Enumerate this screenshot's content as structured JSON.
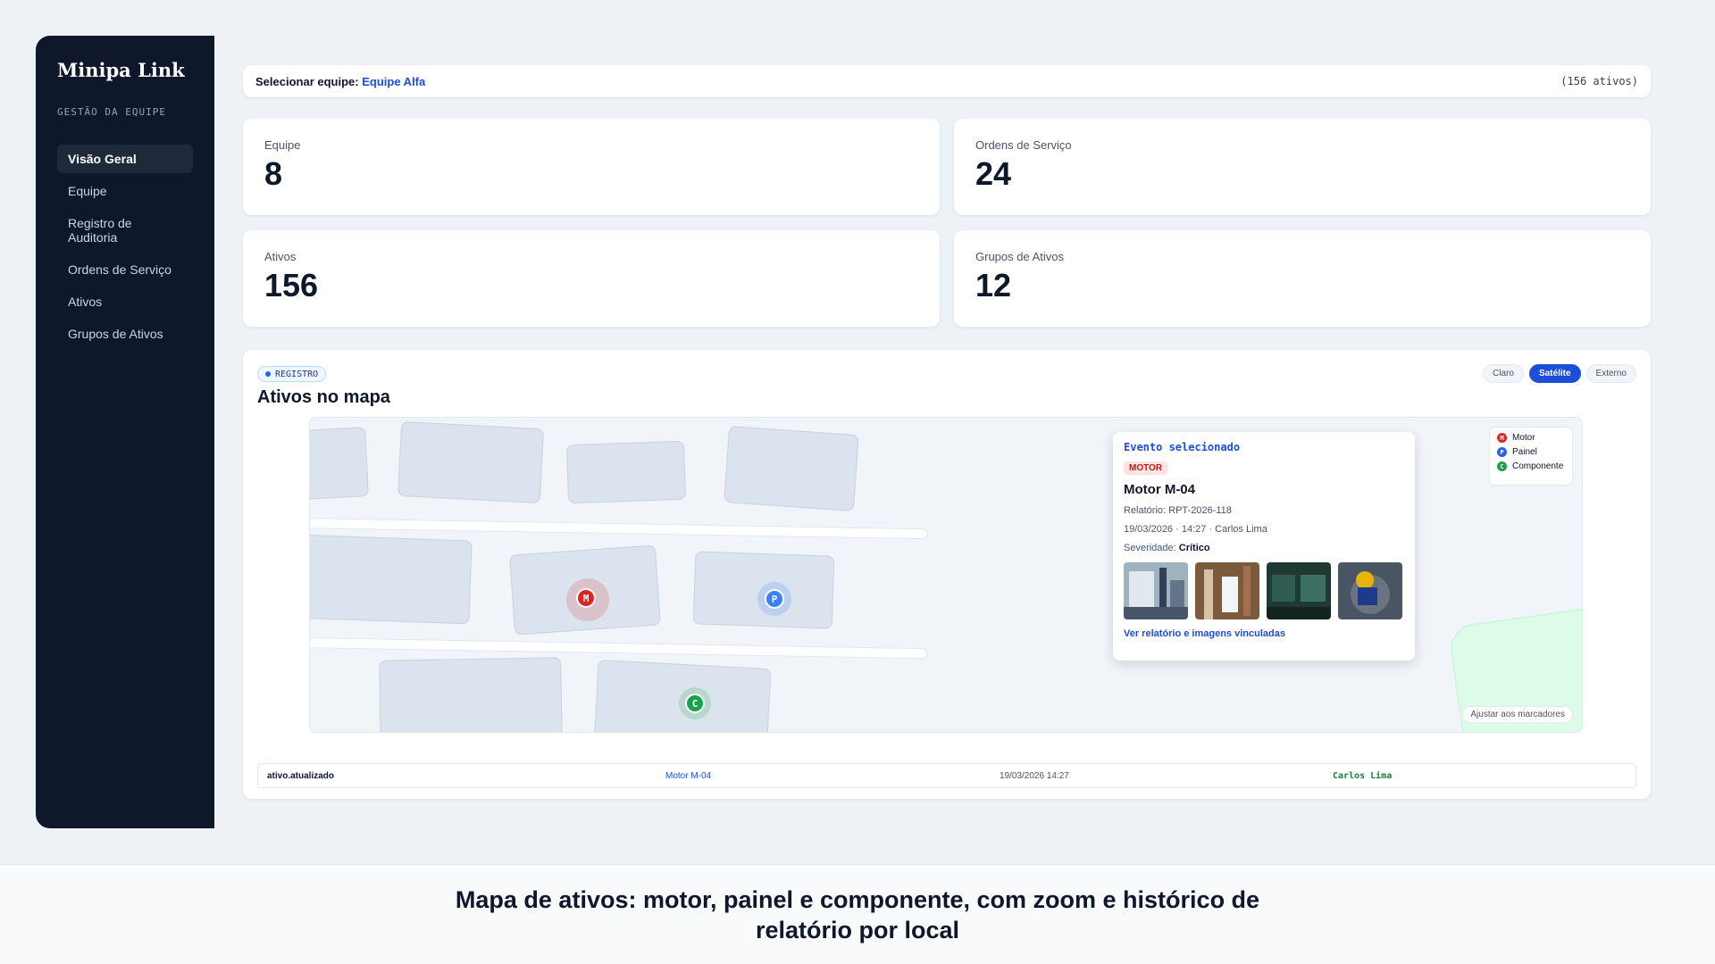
{
  "sidebar": {
    "brand": "Minipa Link",
    "subtitle": "GESTÃO DA EQUIPE",
    "items": [
      {
        "label": "Visão Geral",
        "active": true
      },
      {
        "label": "Equipe"
      },
      {
        "label": "Registro de Auditoria"
      },
      {
        "label": "Ordens de Serviço"
      },
      {
        "label": "Ativos"
      },
      {
        "label": "Grupos de Ativos"
      }
    ]
  },
  "team_bar": {
    "label": "Selecionar equipe:",
    "team": "Equipe Alfa",
    "count": "(156 ativos)"
  },
  "stats": [
    {
      "label": "Equipe",
      "value": "8"
    },
    {
      "label": "Ordens de Serviço",
      "value": "24"
    },
    {
      "label": "Ativos",
      "value": "156"
    },
    {
      "label": "Grupos de Ativos",
      "value": "12"
    }
  ],
  "map_panel": {
    "chip": "REGISTRO",
    "title": "Ativos no mapa",
    "modes": [
      "Claro",
      "Satélite",
      "Externo"
    ],
    "active_mode": "Satélite",
    "markers": [
      {
        "letter": "M",
        "type": "Motor",
        "color": "#dc2626"
      },
      {
        "letter": "P",
        "type": "Painel",
        "color": "#3b82f6"
      },
      {
        "letter": "C",
        "type": "Componente",
        "color": "#16a34a"
      }
    ],
    "legend": [
      {
        "letter": "M",
        "label": "Motor",
        "color": "#dc2626"
      },
      {
        "letter": "P",
        "label": "Painel",
        "color": "#2563eb"
      },
      {
        "letter": "C",
        "label": "Componente",
        "color": "#16a34a"
      }
    ],
    "popup": {
      "title": "Evento selecionado",
      "tag": "MOTOR",
      "name": "Motor M-04",
      "report": "Relatório: RPT-2026-118",
      "meta": "19/03/2026 · 14:27 · Carlos Lima",
      "severity_label": "Severidade:",
      "severity_value": "Crítico",
      "link": "Ver relatório e imagens vinculadas"
    },
    "fit_button": "Ajustar aos marcadores"
  },
  "log": {
    "event": "ativo.atualizado",
    "asset": "Motor M-04",
    "datetime": "19/03/2026 14:27",
    "user": "Carlos Lima"
  },
  "caption": "Mapa de ativos: motor, painel e componente, com zoom e histórico de relatório por local",
  "colors": {
    "accent": "#1d4ed8",
    "sidebar_bg": "#0f172a",
    "critical": "#b91c1c"
  }
}
